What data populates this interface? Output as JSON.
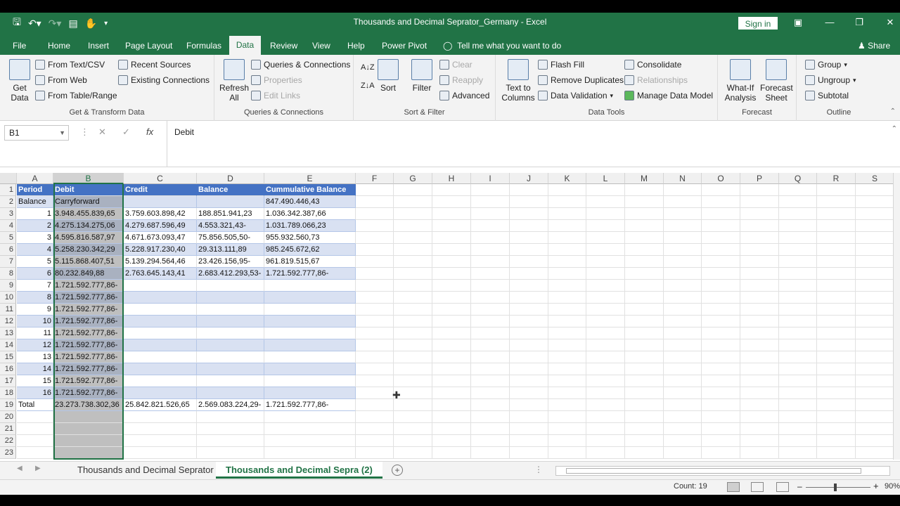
{
  "window": {
    "title": "Thousands and Decimal Seprator_Germany  -  Excel",
    "signin_label": "Sign in"
  },
  "tabs": [
    "File",
    "Home",
    "Insert",
    "Page Layout",
    "Formulas",
    "Data",
    "Review",
    "View",
    "Help",
    "Power Pivot"
  ],
  "active_tab": "Data",
  "tellme": "Tell me what you want to do",
  "share": "Share",
  "ribbon": {
    "get_transform": {
      "label": "Get & Transform Data",
      "get_data": "Get Data",
      "from_text": "From Text/CSV",
      "from_web": "From Web",
      "from_table": "From Table/Range",
      "recent_sources": "Recent Sources",
      "existing_connections": "Existing Connections"
    },
    "queries": {
      "label": "Queries & Connections",
      "refresh_all": "Refresh All",
      "queries_connections": "Queries & Connections",
      "properties": "Properties",
      "edit_links": "Edit Links"
    },
    "sort_filter": {
      "label": "Sort & Filter",
      "sort": "Sort",
      "filter": "Filter",
      "clear": "Clear",
      "reapply": "Reapply",
      "advanced": "Advanced"
    },
    "data_tools": {
      "label": "Data Tools",
      "text_to_columns": "Text to Columns",
      "flash_fill": "Flash Fill",
      "remove_duplicates": "Remove Duplicates",
      "data_validation": "Data Validation",
      "consolidate": "Consolidate",
      "relationships": "Relationships",
      "manage_data_model": "Manage Data Model"
    },
    "forecast": {
      "label": "Forecast",
      "what_if": "What-If Analysis",
      "forecast_sheet": "Forecast Sheet"
    },
    "outline": {
      "label": "Outline",
      "group": "Group",
      "ungroup": "Ungroup",
      "subtotal": "Subtotal"
    }
  },
  "formula_bar": {
    "name_box": "B1",
    "content": "Debit"
  },
  "columns": [
    "A",
    "B",
    "C",
    "D",
    "E",
    "F",
    "G",
    "H",
    "I",
    "J",
    "K",
    "L",
    "M",
    "N",
    "O",
    "P",
    "Q",
    "R",
    "S"
  ],
  "rows": [
    [
      "Period",
      "Debit",
      "Credit",
      "Balance",
      "Cummulative Balance"
    ],
    [
      "Balance",
      "Carryforward",
      "",
      "",
      "847.490.446,43"
    ],
    [
      "1",
      "3.948.455.839,65",
      "3.759.603.898,42",
      "188.851.941,23",
      "1.036.342.387,66"
    ],
    [
      "2",
      "4.275.134.275,06",
      "4.279.687.596,49",
      "4.553.321,43-",
      "1.031.789.066,23"
    ],
    [
      "3",
      "4.595.816.587,97",
      "4.671.673.093,47",
      "75.856.505,50-",
      "955.932.560,73"
    ],
    [
      "4",
      "5.258.230.342,29",
      "5.228.917.230,40",
      "29.313.111,89",
      "985.245.672,62"
    ],
    [
      "5",
      "5.115.868.407,51",
      "5.139.294.564,46",
      "23.426.156,95-",
      "961.819.515,67"
    ],
    [
      "6",
      "80.232.849,88",
      "2.763.645.143,41",
      "2.683.412.293,53-",
      "1.721.592.777,86-"
    ],
    [
      "7",
      "1.721.592.777,86-",
      "",
      "",
      ""
    ],
    [
      "8",
      "1.721.592.777,86-",
      "",
      "",
      ""
    ],
    [
      "9",
      "1.721.592.777,86-",
      "",
      "",
      ""
    ],
    [
      "10",
      "1.721.592.777,86-",
      "",
      "",
      ""
    ],
    [
      "11",
      "1.721.592.777,86-",
      "",
      "",
      ""
    ],
    [
      "12",
      "1.721.592.777,86-",
      "",
      "",
      ""
    ],
    [
      "13",
      "1.721.592.777,86-",
      "",
      "",
      ""
    ],
    [
      "14",
      "1.721.592.777,86-",
      "",
      "",
      ""
    ],
    [
      "15",
      "1.721.592.777,86-",
      "",
      "",
      ""
    ],
    [
      "16",
      "1.721.592.777,86-",
      "",
      "",
      ""
    ],
    [
      "Total",
      "23.273.738.302,36",
      "25.842.821.526,65",
      "2.569.083.224,29-",
      "1.721.592.777,86-"
    ]
  ],
  "row_numbers": [
    "1",
    "2",
    "3",
    "4",
    "5",
    "6",
    "7",
    "8",
    "9",
    "10",
    "11",
    "12",
    "13",
    "14",
    "15",
    "16",
    "17",
    "18",
    "19",
    "20",
    "21",
    "22",
    "23"
  ],
  "sheets": [
    "Thousands and Decimal Seprator",
    "Thousands and Decimal Sepra (2)"
  ],
  "active_sheet": "Thousands and Decimal Sepra (2)",
  "status": {
    "count": "Count: 19",
    "zoom": "90%"
  },
  "colors": {
    "excel_green": "#217346",
    "table_header": "#4472c4",
    "table_band": "#d9e1f2"
  }
}
